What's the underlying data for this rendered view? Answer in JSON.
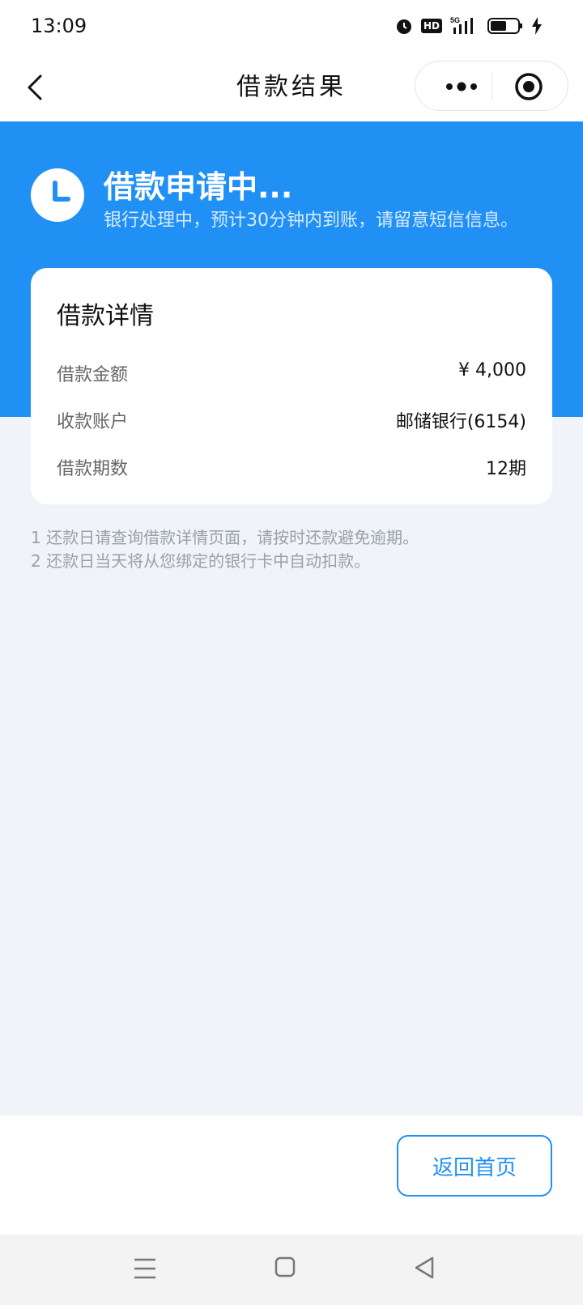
{
  "status_bar": {
    "time": "13:09",
    "hd": "HD",
    "network": "5G"
  },
  "nav": {
    "title": "借款结果"
  },
  "status": {
    "title": "借款申请中...",
    "subtitle": "银行处理中，预计30分钟内到账，请留意短信信息。"
  },
  "details": {
    "title": "借款详情",
    "rows": [
      {
        "label": "借款金额",
        "value": "¥ 4,000"
      },
      {
        "label": "收款账户",
        "value": "邮储银行(6154)"
      },
      {
        "label": "借款期数",
        "value": "12期"
      }
    ]
  },
  "notes": [
    "1 还款日请查询借款详情页面，请按时还款避免逾期。",
    "2 还款日当天将从您绑定的银行卡中自动扣款。"
  ],
  "footer": {
    "home_button": "返回首页"
  },
  "colors": {
    "accent": "#2190f4",
    "background": "#f0f4f9"
  }
}
